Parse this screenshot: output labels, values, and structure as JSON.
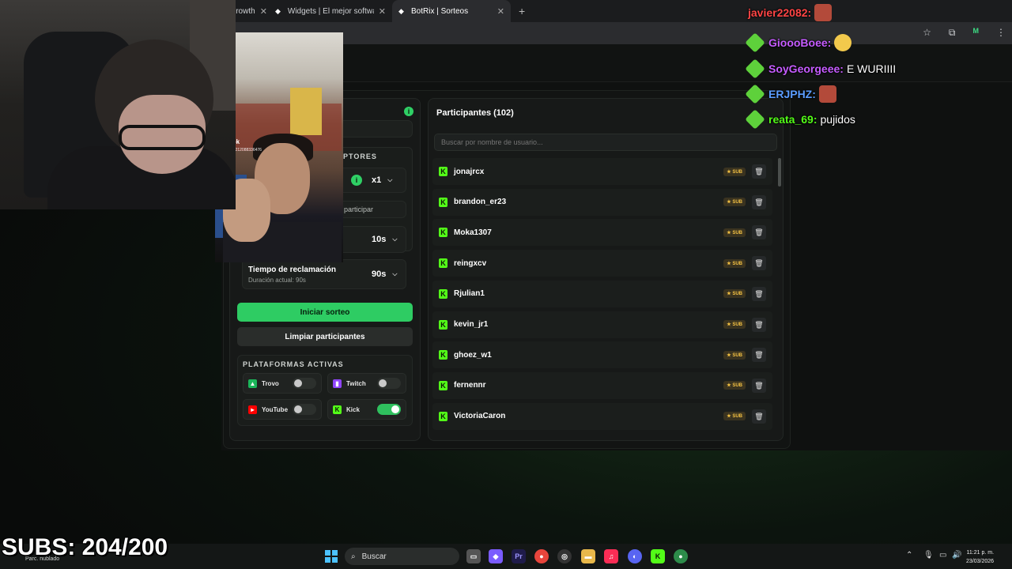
{
  "browser": {
    "tabs": [
      {
        "label": "irowth",
        "active": false
      },
      {
        "label": "Widgets | El mejor software pa",
        "active": false
      },
      {
        "label": "BotRix | Sorteos",
        "active": true
      }
    ],
    "new_tab": "+",
    "profile": "M"
  },
  "config": {
    "section_participants_label": "PTORES",
    "winners_select": "x1",
    "participate_hint": "participar",
    "timer_select": "10s",
    "claim_title": "Tiempo de reclamación",
    "claim_subtitle": "Duración actual: 90s",
    "claim_select": "90s",
    "start_button": "Iniciar sorteo",
    "clear_button": "Limpiar participantes",
    "platforms_title": "PLATAFORMAS ACTIVAS",
    "platforms": [
      {
        "name": "Trovo",
        "icon": "trovo-icon",
        "color": "#1bb65a",
        "enabled": false
      },
      {
        "name": "Twitch",
        "icon": "twitch-icon",
        "color": "#9146ff",
        "enabled": false
      },
      {
        "name": "YouTube",
        "icon": "youtube-icon",
        "color": "#ff0000",
        "enabled": false
      },
      {
        "name": "Kick",
        "icon": "kick-icon",
        "color": "#53fc18",
        "enabled": true
      }
    ]
  },
  "participants": {
    "title": "Participantes (102)",
    "search_placeholder": "Buscar por nombre de usuario...",
    "badge": "SUB",
    "list": [
      "jonajrcx",
      "brandon_er23",
      "Moka1307",
      "reingxcv",
      "Rjulian1",
      "kevin_jr1",
      "ghoez_w1",
      "fernennr",
      "VictoriaCaron"
    ]
  },
  "tiktok": {
    "logo": "TikTok",
    "handle": "@user7212088336476"
  },
  "chat": [
    {
      "user": "javier22082:",
      "color": "#ff4545",
      "message": "",
      "emote": true
    },
    {
      "user": "GioooBoee:",
      "color": "#c65cff",
      "message": "",
      "emote": true
    },
    {
      "user": "SoyGeorgeee:",
      "color": "#c65cff",
      "message": "E WURIIII",
      "emote": false
    },
    {
      "user": "ERJPHZ:",
      "color": "#5b9dff",
      "message": "",
      "emote": true
    },
    {
      "user": "reata_69:",
      "color": "#53fc18",
      "message": "pujidos",
      "emote": false
    }
  ],
  "overlay": {
    "subs": "SUBS: 204/200"
  },
  "taskbar": {
    "weather": "Parc. nublado",
    "search": "Buscar",
    "time": "11:21 p. m.",
    "date": "23/03/2026"
  }
}
